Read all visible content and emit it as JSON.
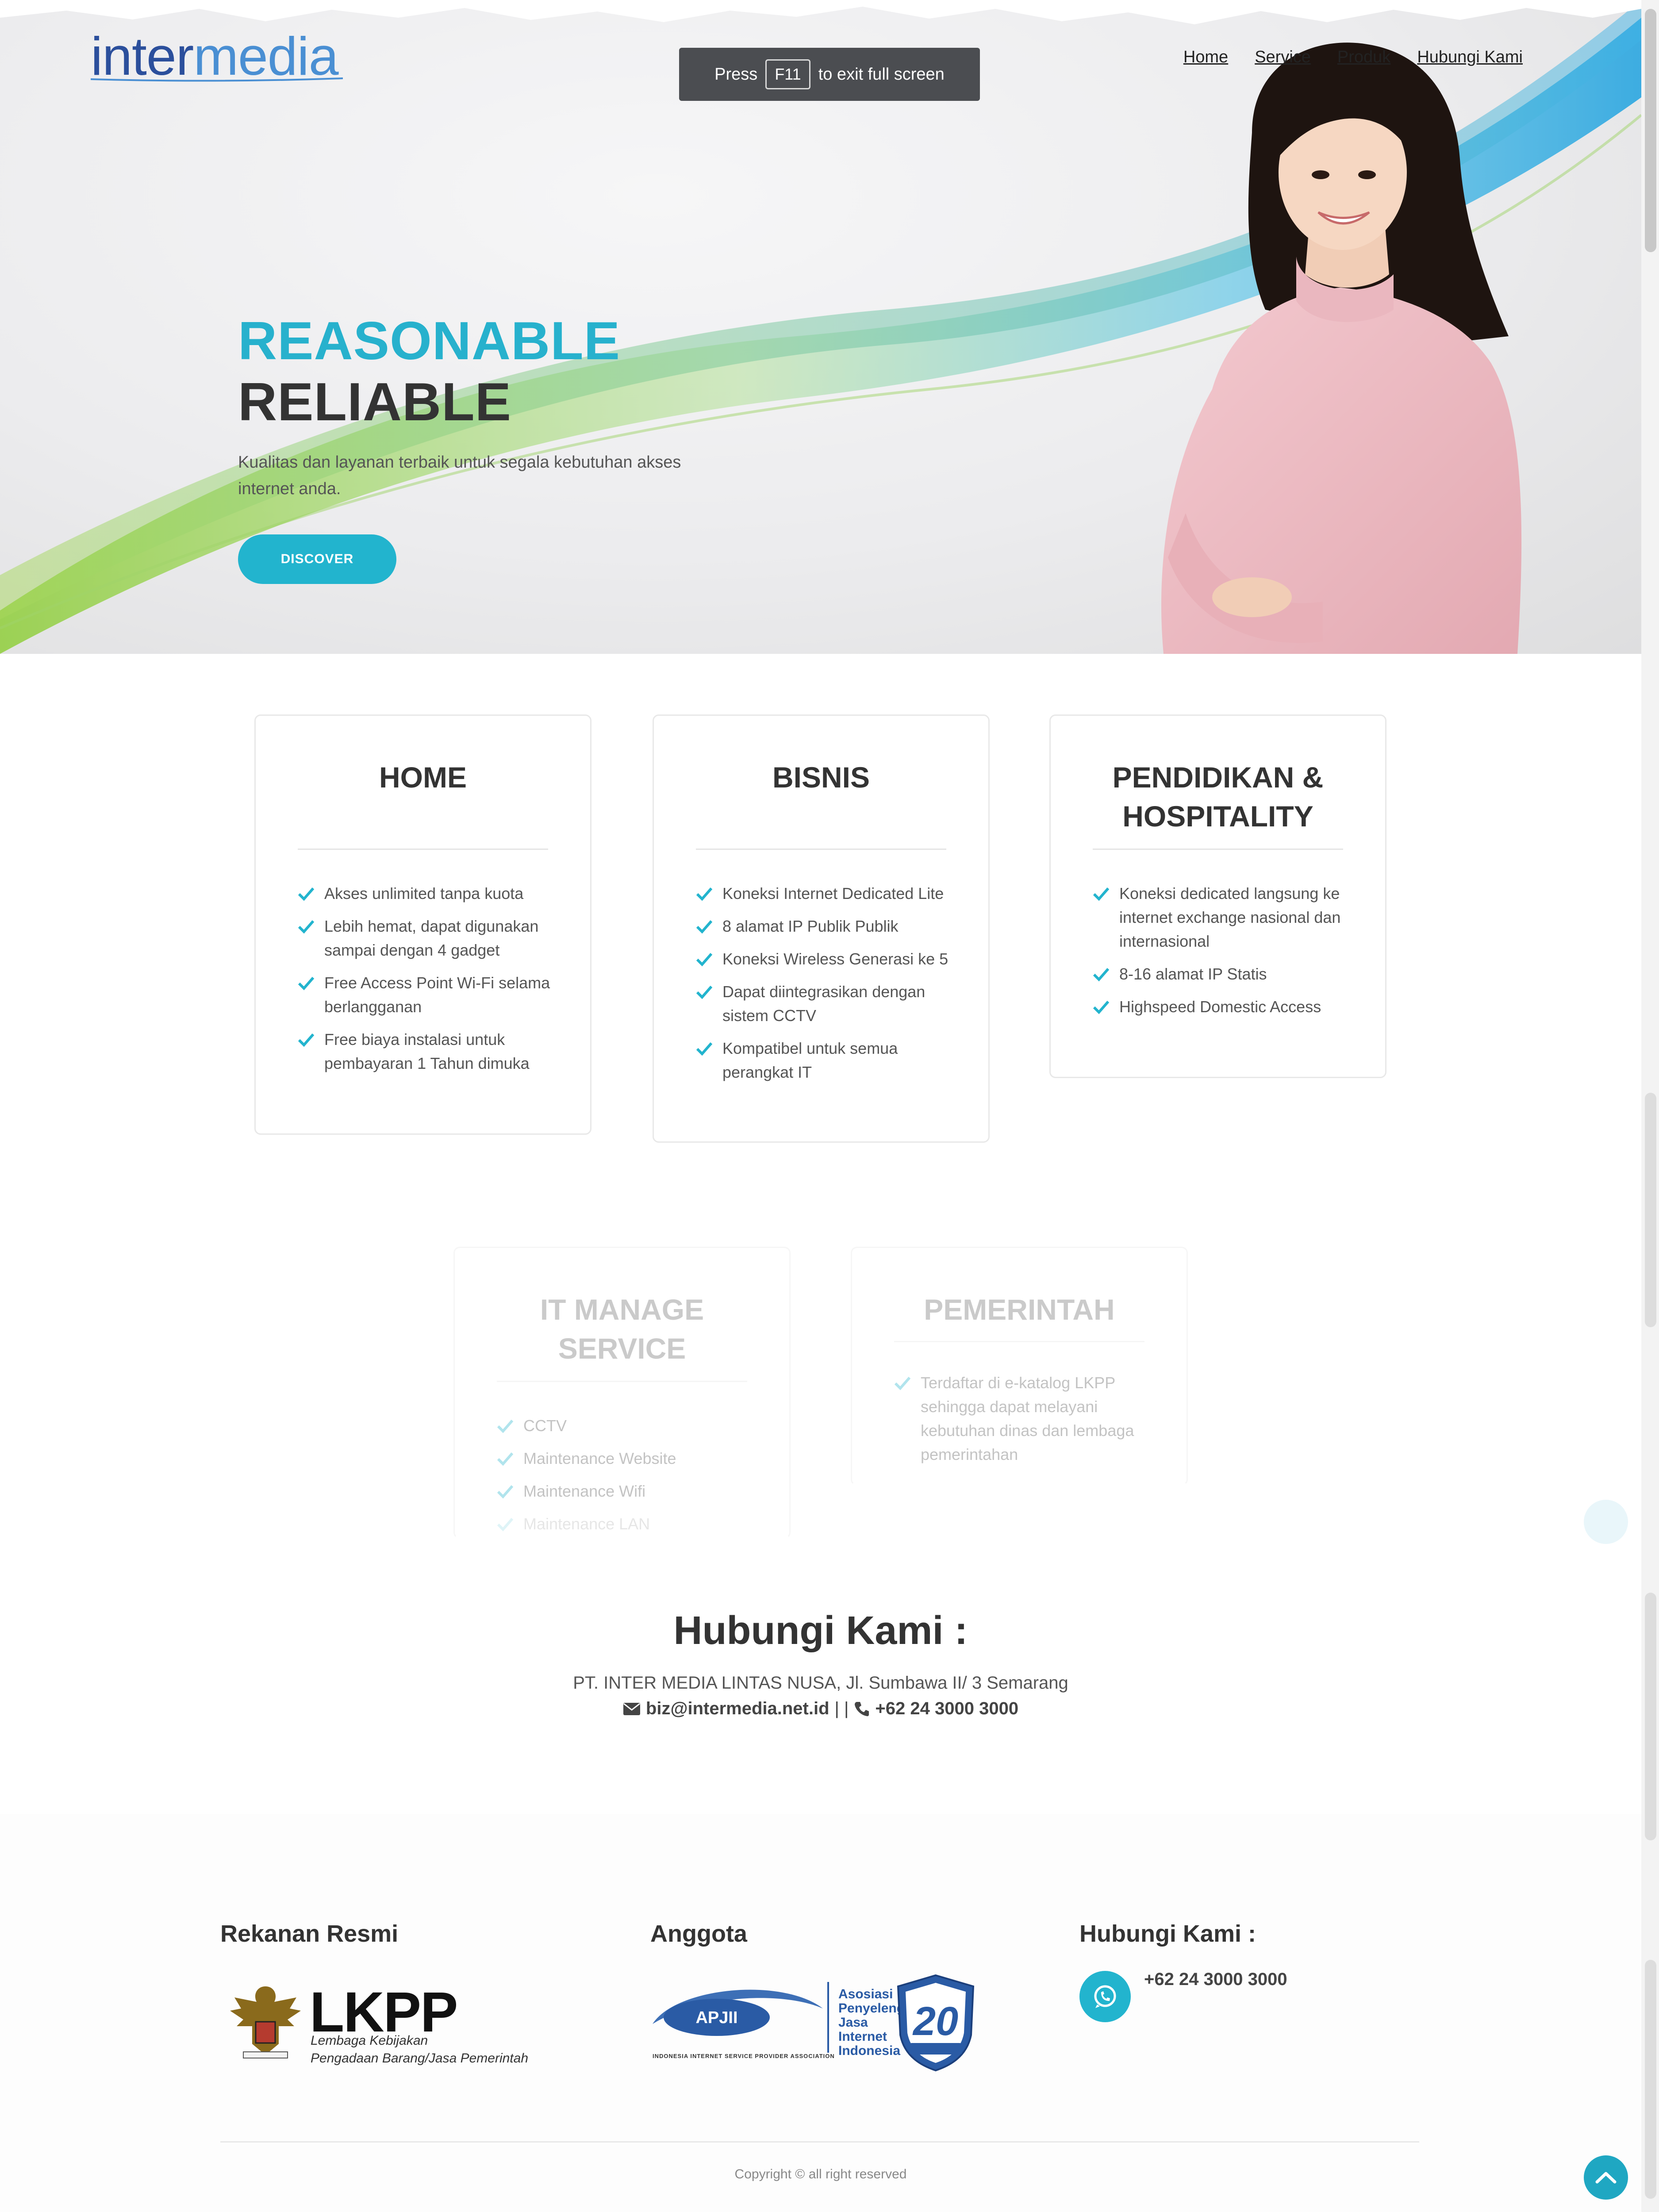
{
  "brand": {
    "name_part1": "inter",
    "name_part2": "media"
  },
  "fullscreen_hint": {
    "press": "Press",
    "key": "F11",
    "rest": "to exit full screen"
  },
  "nav": [
    "Home",
    "Service",
    "Produk",
    "Hubungi Kami"
  ],
  "hero": {
    "heading_line1": "REASONABLE",
    "heading_line2": "RELIABLE",
    "text": "Kualitas dan layanan terbaik untuk segala kebutuhan akses internet anda.",
    "button": "DISCOVER"
  },
  "cards": [
    {
      "title": "HOME",
      "items": [
        "Akses unlimited tanpa kuota",
        "Lebih hemat, dapat digunakan sampai dengan 4 gadget",
        "Free Access Point Wi-Fi selama berlangganan",
        "Free biaya instalasi untuk pembayaran 1 Tahun dimuka"
      ]
    },
    {
      "title": "BISNIS",
      "items": [
        "Koneksi Internet Dedicated Lite",
        "8 alamat IP Publik Publik",
        "Koneksi Wireless Generasi ke 5",
        "Dapat diintegrasikan dengan sistem CCTV",
        "Kompatibel untuk semua perangkat IT"
      ]
    },
    {
      "title": "PENDIDIKAN & HOSPITALITY",
      "items": [
        "Koneksi dedicated langsung ke internet exchange nasional dan internasional",
        "8-16 alamat IP Statis",
        "Highspeed Domestic Access"
      ]
    },
    {
      "title": "IT MANAGE SERVICE",
      "items": [
        "CCTV",
        "Maintenance Website",
        "Maintenance Wifi",
        "Maintenance LAN"
      ]
    },
    {
      "title": "PEMERINTAH",
      "items": [
        "Terdaftar di e-katalog LKPP sehingga dapat melayani kebutuhan dinas dan lembaga pemerintahan"
      ]
    }
  ],
  "contact": {
    "title": "Hubungi Kami :",
    "address": "PT. INTER MEDIA LINTAS NUSA, Jl. Sumbawa II/ 3 Semarang",
    "email": "biz@intermedia.net.id",
    "separator": "| |",
    "phone": "+62 24 3000 3000"
  },
  "footer": {
    "partner_title": "Rekanan Resmi",
    "lkpp": "LKPP",
    "lkpp_sub1": "Lembaga Kebijakan",
    "lkpp_sub2": "Pengadaan Barang/Jasa Pemerintah",
    "member_title": "Anggota",
    "apjii": "APJII",
    "apjii_lines": [
      "Asosiasi",
      "Penyelenggara",
      "Jasa",
      "Internet",
      "Indonesia"
    ],
    "apjii_footer": "INDONESIA INTERNET SERVICE PROVIDER ASSOCIATION",
    "anniv": "20",
    "contact_title": "Hubungi Kami :",
    "phone": "+62 24 3000 3000",
    "copyright": "Copyright © all right reserved"
  },
  "colors": {
    "accent": "#22b4ce",
    "brand_dark": "#2b4f9c",
    "brand_light": "#4a8fd3",
    "text_dark": "#333333"
  },
  "icons": [
    "check-icon",
    "envelope-icon",
    "phone-icon",
    "whatsapp-icon",
    "chevron-up-icon"
  ]
}
